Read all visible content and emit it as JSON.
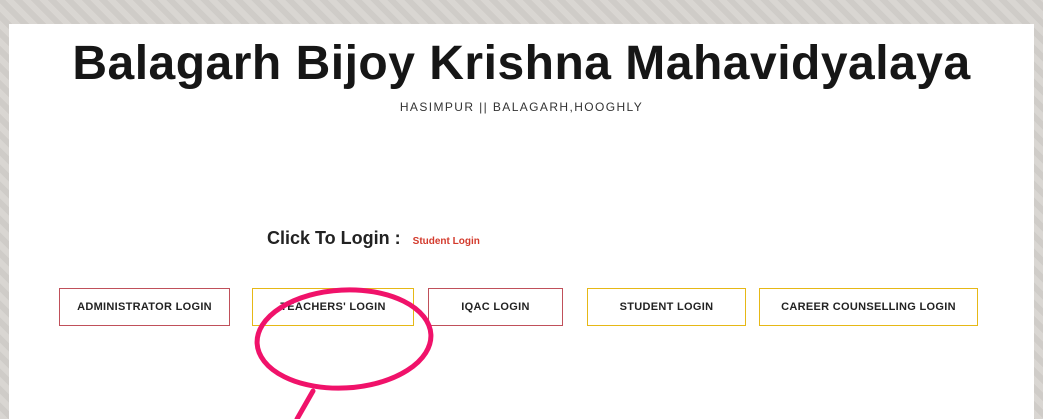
{
  "header": {
    "title": "Balagarh Bijoy Krishna Mahavidyalaya",
    "subtitle": "HASIMPUR || BALAGARH,HOOGHLY"
  },
  "login": {
    "label": "Click To Login :",
    "link_text": "Student Login"
  },
  "buttons": {
    "administrator": "ADMINISTRATOR LOGIN",
    "teachers": "TEACHERS' LOGIN",
    "iqac": "IQAC LOGIN",
    "student": "STUDENT LOGIN",
    "career": "CAREER COUNSELLING LOGIN"
  },
  "colors": {
    "annotation": "#f0126a",
    "link": "#d33a2c",
    "border_red": "#c0505a",
    "border_yellow": "#e6b816"
  }
}
